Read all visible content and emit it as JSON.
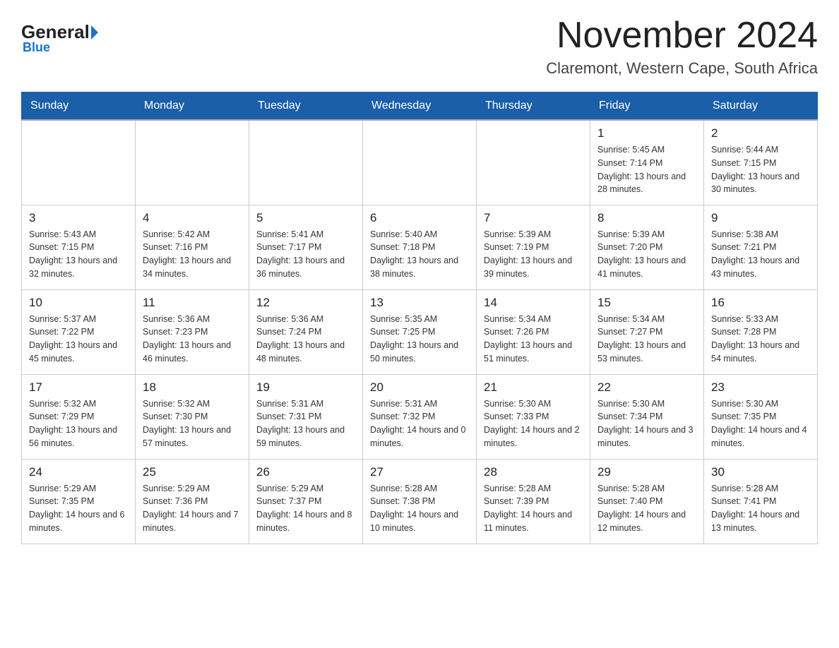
{
  "logo": {
    "text_general": "General",
    "text_blue": "Blue"
  },
  "title": "November 2024",
  "subtitle": "Claremont, Western Cape, South Africa",
  "days_of_week": [
    "Sunday",
    "Monday",
    "Tuesday",
    "Wednesday",
    "Thursday",
    "Friday",
    "Saturday"
  ],
  "weeks": [
    [
      {
        "day": "",
        "info": ""
      },
      {
        "day": "",
        "info": ""
      },
      {
        "day": "",
        "info": ""
      },
      {
        "day": "",
        "info": ""
      },
      {
        "day": "",
        "info": ""
      },
      {
        "day": "1",
        "info": "Sunrise: 5:45 AM\nSunset: 7:14 PM\nDaylight: 13 hours and 28 minutes."
      },
      {
        "day": "2",
        "info": "Sunrise: 5:44 AM\nSunset: 7:15 PM\nDaylight: 13 hours and 30 minutes."
      }
    ],
    [
      {
        "day": "3",
        "info": "Sunrise: 5:43 AM\nSunset: 7:15 PM\nDaylight: 13 hours and 32 minutes."
      },
      {
        "day": "4",
        "info": "Sunrise: 5:42 AM\nSunset: 7:16 PM\nDaylight: 13 hours and 34 minutes."
      },
      {
        "day": "5",
        "info": "Sunrise: 5:41 AM\nSunset: 7:17 PM\nDaylight: 13 hours and 36 minutes."
      },
      {
        "day": "6",
        "info": "Sunrise: 5:40 AM\nSunset: 7:18 PM\nDaylight: 13 hours and 38 minutes."
      },
      {
        "day": "7",
        "info": "Sunrise: 5:39 AM\nSunset: 7:19 PM\nDaylight: 13 hours and 39 minutes."
      },
      {
        "day": "8",
        "info": "Sunrise: 5:39 AM\nSunset: 7:20 PM\nDaylight: 13 hours and 41 minutes."
      },
      {
        "day": "9",
        "info": "Sunrise: 5:38 AM\nSunset: 7:21 PM\nDaylight: 13 hours and 43 minutes."
      }
    ],
    [
      {
        "day": "10",
        "info": "Sunrise: 5:37 AM\nSunset: 7:22 PM\nDaylight: 13 hours and 45 minutes."
      },
      {
        "day": "11",
        "info": "Sunrise: 5:36 AM\nSunset: 7:23 PM\nDaylight: 13 hours and 46 minutes."
      },
      {
        "day": "12",
        "info": "Sunrise: 5:36 AM\nSunset: 7:24 PM\nDaylight: 13 hours and 48 minutes."
      },
      {
        "day": "13",
        "info": "Sunrise: 5:35 AM\nSunset: 7:25 PM\nDaylight: 13 hours and 50 minutes."
      },
      {
        "day": "14",
        "info": "Sunrise: 5:34 AM\nSunset: 7:26 PM\nDaylight: 13 hours and 51 minutes."
      },
      {
        "day": "15",
        "info": "Sunrise: 5:34 AM\nSunset: 7:27 PM\nDaylight: 13 hours and 53 minutes."
      },
      {
        "day": "16",
        "info": "Sunrise: 5:33 AM\nSunset: 7:28 PM\nDaylight: 13 hours and 54 minutes."
      }
    ],
    [
      {
        "day": "17",
        "info": "Sunrise: 5:32 AM\nSunset: 7:29 PM\nDaylight: 13 hours and 56 minutes."
      },
      {
        "day": "18",
        "info": "Sunrise: 5:32 AM\nSunset: 7:30 PM\nDaylight: 13 hours and 57 minutes."
      },
      {
        "day": "19",
        "info": "Sunrise: 5:31 AM\nSunset: 7:31 PM\nDaylight: 13 hours and 59 minutes."
      },
      {
        "day": "20",
        "info": "Sunrise: 5:31 AM\nSunset: 7:32 PM\nDaylight: 14 hours and 0 minutes."
      },
      {
        "day": "21",
        "info": "Sunrise: 5:30 AM\nSunset: 7:33 PM\nDaylight: 14 hours and 2 minutes."
      },
      {
        "day": "22",
        "info": "Sunrise: 5:30 AM\nSunset: 7:34 PM\nDaylight: 14 hours and 3 minutes."
      },
      {
        "day": "23",
        "info": "Sunrise: 5:30 AM\nSunset: 7:35 PM\nDaylight: 14 hours and 4 minutes."
      }
    ],
    [
      {
        "day": "24",
        "info": "Sunrise: 5:29 AM\nSunset: 7:35 PM\nDaylight: 14 hours and 6 minutes."
      },
      {
        "day": "25",
        "info": "Sunrise: 5:29 AM\nSunset: 7:36 PM\nDaylight: 14 hours and 7 minutes."
      },
      {
        "day": "26",
        "info": "Sunrise: 5:29 AM\nSunset: 7:37 PM\nDaylight: 14 hours and 8 minutes."
      },
      {
        "day": "27",
        "info": "Sunrise: 5:28 AM\nSunset: 7:38 PM\nDaylight: 14 hours and 10 minutes."
      },
      {
        "day": "28",
        "info": "Sunrise: 5:28 AM\nSunset: 7:39 PM\nDaylight: 14 hours and 11 minutes."
      },
      {
        "day": "29",
        "info": "Sunrise: 5:28 AM\nSunset: 7:40 PM\nDaylight: 14 hours and 12 minutes."
      },
      {
        "day": "30",
        "info": "Sunrise: 5:28 AM\nSunset: 7:41 PM\nDaylight: 14 hours and 13 minutes."
      }
    ]
  ]
}
